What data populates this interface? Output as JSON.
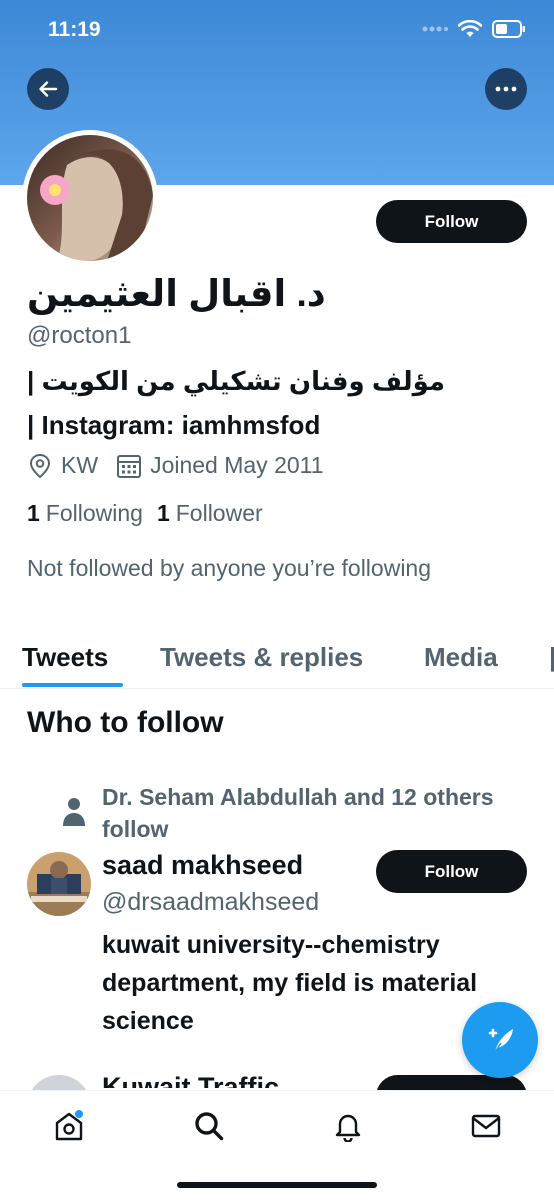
{
  "status_bar": {
    "time": "11:19"
  },
  "profile": {
    "display_name": "د. اقبال العثيمين",
    "handle": "@rocton1",
    "follow_label": "Follow",
    "bio_line1": "مؤلف وفنان تشكيلي من الكويت |",
    "bio_line2": "| Instagram: iamhmsfod",
    "location": "KW",
    "joined": "Joined May 2011",
    "following_count": "1",
    "following_label": "Following",
    "followers_count": "1",
    "followers_label": "Follower",
    "not_followed_text": "Not followed by anyone you’re following"
  },
  "tabs": [
    {
      "label": "Tweets",
      "active": true
    },
    {
      "label": "Tweets & replies",
      "active": false
    },
    {
      "label": "Media",
      "active": false
    }
  ],
  "who_to_follow": {
    "title": "Who to follow",
    "suggestions": [
      {
        "social_context": "Dr. Seham Alabdullah and 12 others follow",
        "name": "saad makhseed",
        "handle": "@drsaadmakhseed",
        "bio": "kuwait university--chemistry department, my field is material science",
        "follow_label": "Follow"
      },
      {
        "name": "Kuwait Traffic"
      }
    ]
  },
  "bottom_nav": [
    "home-icon",
    "search-icon",
    "notifications-icon",
    "messages-icon"
  ],
  "colors": {
    "accent": "#1d9bf0",
    "banner": "#4a96e0",
    "text": "#0f1419",
    "secondary": "#536471"
  }
}
